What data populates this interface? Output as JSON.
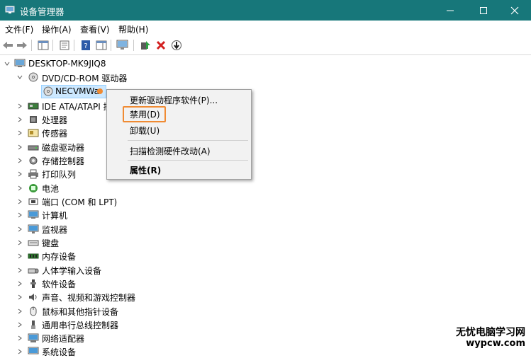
{
  "window": {
    "title": "设备管理器"
  },
  "menu": {
    "file": "文件(F)",
    "action": "操作(A)",
    "view": "查看(V)",
    "help": "帮助(H)"
  },
  "tree": {
    "root": "DESKTOP-MK9JIQ8",
    "dvd": "DVD/CD-ROM 驱动器",
    "dvd_child": "NECVMWa",
    "ide": "IDE ATA/ATAPI 控",
    "processor": "处理器",
    "sensor": "传感器",
    "disk": "磁盘驱动器",
    "storage": "存储控制器",
    "print": "打印队列",
    "battery": "电池",
    "ports": "端口 (COM 和 LPT)",
    "computer": "计算机",
    "monitor": "监视器",
    "keyboard": "键盘",
    "memory": "内存设备",
    "hid": "人体学输入设备",
    "software": "软件设备",
    "audio": "声音、视频和游戏控制器",
    "mouse": "鼠标和其他指针设备",
    "usb": "通用串行总线控制器",
    "network": "网络适配器",
    "system": "系统设备"
  },
  "context_menu": {
    "update": "更新驱动程序软件(P)...",
    "disable": "禁用(D)",
    "uninstall": "卸载(U)",
    "scan": "扫描检测硬件改动(A)",
    "properties": "属性(R)"
  },
  "watermark": {
    "line1": "无忧电脑学习网",
    "line2": "wypcw.com"
  },
  "colors": {
    "titlebar": "#17777a",
    "highlight": "#f08b33",
    "selection": "#cce8ff"
  }
}
